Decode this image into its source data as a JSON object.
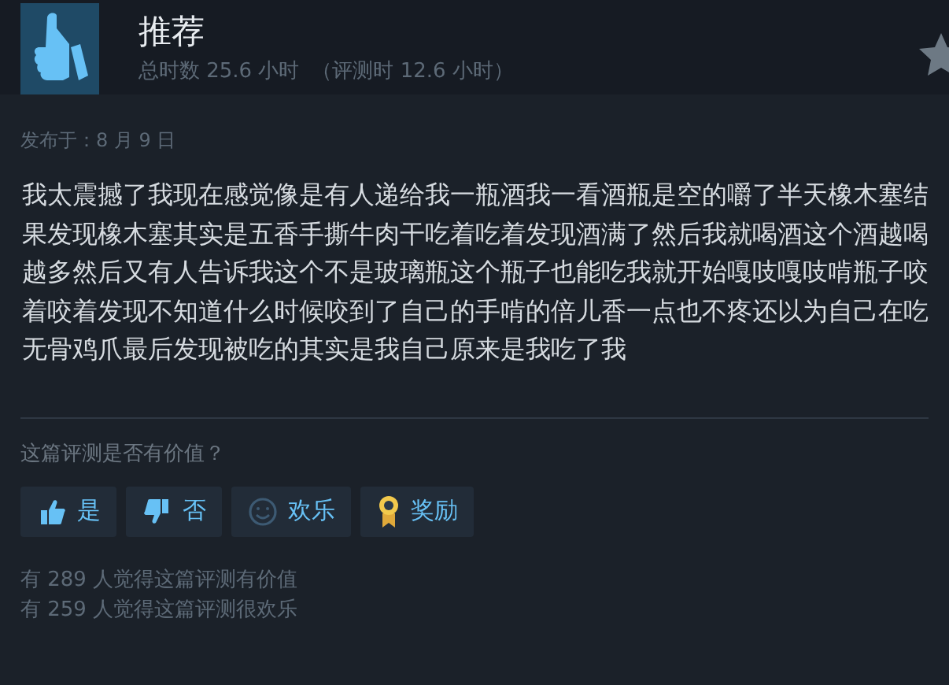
{
  "review": {
    "verdict": "推荐",
    "playtime": "总时数 25.6 小时",
    "review_time": "（评测时 12.6 小时）",
    "posted": "发布于：8 月 9 日",
    "body": "我太震撼了我现在感觉像是有人递给我一瓶酒我一看酒瓶是空的嚼了半天橡木塞结果发现橡木塞其实是五香手撕牛肉干吃着吃着发现酒满了然后我就喝酒这个酒越喝越多然后又有人告诉我这个不是玻璃瓶这个瓶子也能吃我就开始嘎吱嘎吱啃瓶子咬着咬着发现不知道什么时候咬到了自己的手啃的倍儿香一点也不疼还以为自己在吃无骨鸡爪最后发现被吃的其实是我自己原来是我吃了我"
  },
  "feedback": {
    "question": "这篇评测是否有价值？",
    "buttons": [
      {
        "kind": "yes",
        "label": "是"
      },
      {
        "kind": "no",
        "label": "否"
      },
      {
        "kind": "funny",
        "label": "欢乐"
      },
      {
        "kind": "award",
        "label": "奖励"
      }
    ],
    "counts": [
      "有 289 人觉得这篇评测有价值",
      "有 259 人觉得这篇评测很欢乐"
    ]
  }
}
